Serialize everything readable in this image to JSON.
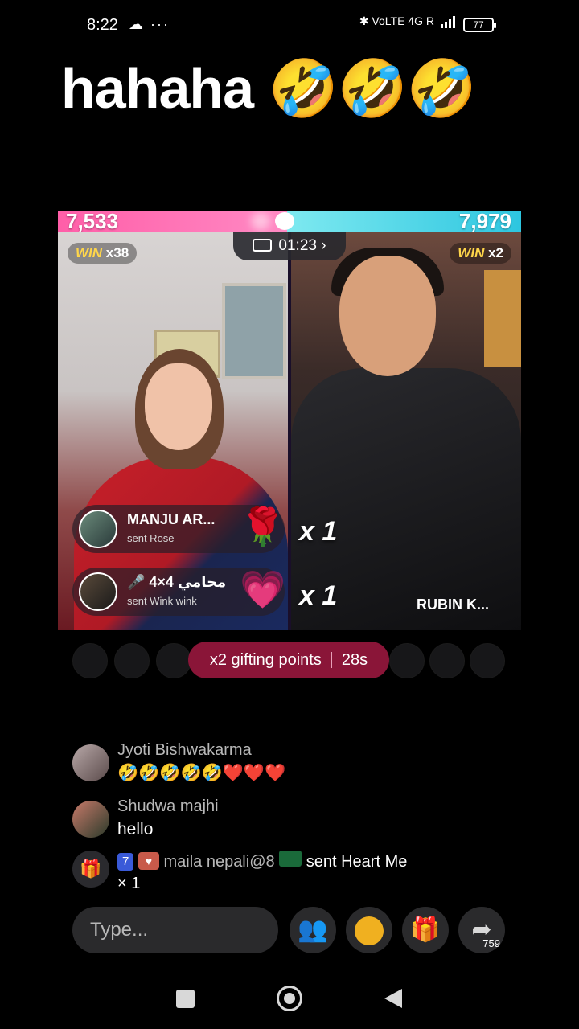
{
  "status_bar": {
    "time": "8:22",
    "left_icons": "☁ ···",
    "right_icons": "✱ VoLTE 4G R",
    "battery": "77"
  },
  "caption": "hahaha 🤣🤣🤣",
  "battle": {
    "score_left": "7,533",
    "score_right": "7,979",
    "win_left_label": "WIN",
    "win_left_count": "x38",
    "win_right_label": "WIN",
    "win_right_count": "x2",
    "timer": "01:23",
    "timer_chevron": "›",
    "gifts": [
      {
        "name": "MANJU AR...",
        "sub": "sent Rose",
        "icon": "🌹",
        "combo": "x 1"
      },
      {
        "name": "🎤 4×4 محامي",
        "sub": "sent Wink wink",
        "icon": "💗",
        "combo": "x 1"
      }
    ],
    "right_host_name": "RUBIN  K..."
  },
  "points_bar": {
    "label": "x2 gifting points",
    "countdown": "28s"
  },
  "chat": [
    {
      "user": "Jyoti Bishwakarma",
      "message": "🤣🤣🤣🤣🤣❤️❤️❤️"
    },
    {
      "user": "Shudwa majhi",
      "message": "hello"
    }
  ],
  "gift_notice": {
    "level": "7",
    "user": "maila nepali@8",
    "action": "sent Heart Me",
    "count": "× 1"
  },
  "input": {
    "placeholder": "Type..."
  },
  "controls": {
    "share_count": "759",
    "people_icon": "👥",
    "gift_icon": "🎁",
    "share_icon": "➦"
  },
  "colors": {
    "score_left": "#ff5ea8",
    "score_right": "#2dc6e0",
    "points_pill": "#8a1538",
    "accent": "#ff3d8b"
  }
}
